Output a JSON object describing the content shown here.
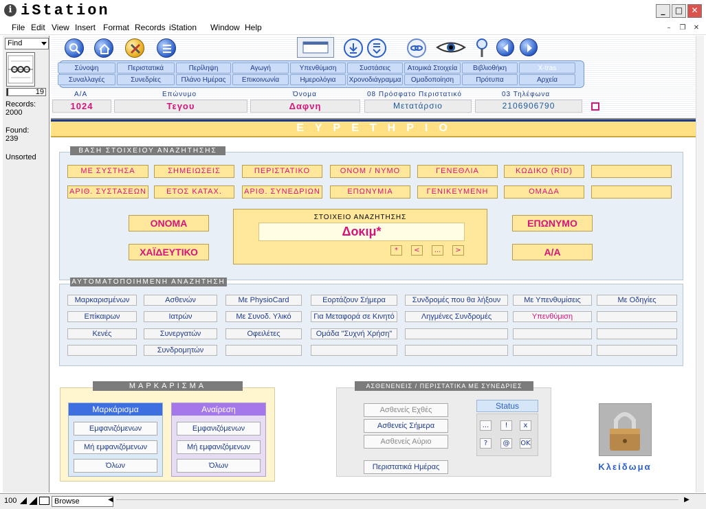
{
  "window": {
    "title": "iStation",
    "app_icon": "i"
  },
  "menu": [
    "File",
    "Edit",
    "View",
    "Insert",
    "Format",
    "Records",
    "iStation",
    "Window",
    "Help"
  ],
  "sidebar": {
    "mode": "Find",
    "record_num": "19",
    "records_label": "Records:",
    "records_val": "2000",
    "found_label": "Found:",
    "found_val": "239",
    "sort": "Unsorted"
  },
  "nav": {
    "row1": [
      "Σύνοψη",
      "Περιστατικά",
      "Περίληψη",
      "Αγωγή",
      "Υπενθύμιση",
      "Συστάσεις",
      "Ατομικά Στοιχεία",
      "Βιβλιοθήκη",
      "X-tras"
    ],
    "row2": [
      "Συναλλαγές",
      "Συνεδρίες",
      "Πλάνο Ημέρας",
      "Επικοινωνία",
      "Ημερολόγια",
      "Χρονοδιάγραμμα",
      "Ομαδοποίηση",
      "Πρότυπα",
      "Αρχεία"
    ]
  },
  "header": {
    "aa_label": "Α/Α",
    "aa_val": "1024",
    "surname_label": "Επώνυμο",
    "surname_val": "Τεγου",
    "name_label": "Όνομα",
    "name_val": "Δαφνη",
    "recent_label": "08  Πρόσφατο Περιστατικό",
    "recent_val": "Μετατάρσιο",
    "phone_label": "03  Τηλέφωνα",
    "phone_val": "2106906790"
  },
  "banner": "ΕΥΡΕΤΗΡΙΟ",
  "search_base": {
    "title": "ΒΑΣΗ ΣΤΟΙΧΕΙΟΥ ΑΝΑΖΗΤΗΣΗΣ",
    "row1": [
      "ΜΕ ΣΥΣΤΗΣΑ",
      "ΣΗΜΕΙΩΣΕΙΣ",
      "ΠΕΡΙΣΤΑΤΙΚΟ",
      "ΟΝΟΜ / ΝΥΜΟ",
      "ΓΕΝΕΘΛΙΑ",
      "ΚΩΔΙΚΟ (RID)",
      ""
    ],
    "row2": [
      "ΑΡΙΘ. ΣΥΣΤΑΣΕΩΝ",
      "ΕΤΟΣ ΚΑΤΑΧ.",
      "ΑΡΙΘ. ΣΥΝΕΔΡΙΩΝ",
      "ΕΠΩΝΥΜΙΑ",
      "ΓΕΝΙΚΕΥΜΕΝΗ",
      "ΟΜΑΔΑ",
      ""
    ],
    "onoma": "ΟΝΟΜΑ",
    "xaideftiko": "ΧΑΪΔΕΥΤΙΚΟ",
    "eponymo": "ΕΠΩΝΥΜΟ",
    "aa": "Α/Α",
    "box_title": "ΣΤΟΙΧΕΙΟ ΑΝΑΖΗΤΗΣΗΣ",
    "query": "Δοκιμ*",
    "symbols": [
      "*",
      "<",
      "...",
      ">"
    ]
  },
  "auto_search": {
    "title": "ΑΥΤΟΜΑΤΟΠΟΙΗΜΕΝΗ ΑΝΑΖΗΤΗΣΗ",
    "col1": [
      "Μαρκαρισμένων",
      "Επίκαιρων",
      "Κενές",
      ""
    ],
    "col2": [
      "Ασθενών",
      "Ιατρών",
      "Συνεργατών",
      "Συνδρομητών"
    ],
    "col3": [
      "Με PhysioCard",
      "Με Συνοδ. Υλικό",
      "Οφειλέτες",
      ""
    ],
    "col4": [
      "Εορτάζουν Σήμερα",
      "Για Μεταφορά σε Κινητό",
      "Ομάδα \"Συχνή Χρήση\"",
      ""
    ],
    "col5": [
      "Συνδρομές που θα λήξουν",
      "Ληγμένες Συνδρομές",
      "",
      ""
    ],
    "col6": [
      "Με Υπενθυμίσεις",
      "Υπενθύμιση",
      "",
      ""
    ],
    "col7": [
      "Με Οδηγίες",
      "",
      "",
      ""
    ]
  },
  "marking": {
    "title": "ΜΑΡΚΑΡΙΣΜΑ",
    "mark_head": "Μαρκάρισμα",
    "unmark_head": "Αναίρεση",
    "items": [
      "Εμφανιζόμενων",
      "Μή εμφανιζόμενων",
      "Όλων"
    ]
  },
  "sessions": {
    "title": "ΑΣΘΕΝΕΝΕΙΣ / ΠΕΡΙΣΤΑΤΙΚΑ ΜΕ ΣΥΝΕΔΡΙΕΣ",
    "yesterday": "Ασθενείς Εχθές",
    "today": "Ασθενείς Σήμερα",
    "tomorrow": "Ασθενείς Αύριο",
    "daily": "Περιστατικά Ημέρας",
    "status_label": "Status",
    "status_buttons": [
      "...",
      "!",
      "x",
      "?",
      "@",
      "OK"
    ]
  },
  "lock": {
    "label": "Κλείδωμα"
  },
  "statusbar": {
    "zoom": "100",
    "mode": "Browse"
  },
  "colors": {
    "banner": "#ffe082",
    "accent": "#d4147a",
    "nav_text": "#1d3a8c"
  }
}
